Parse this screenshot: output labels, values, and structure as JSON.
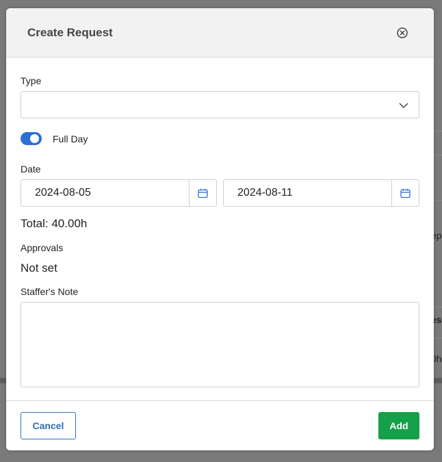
{
  "modal": {
    "title": "Create Request"
  },
  "form": {
    "type_label": "Type",
    "type_value": "",
    "full_day_label": "Full Day",
    "full_day_enabled": true,
    "date_label": "Date",
    "start_date": "2024-08-05",
    "end_date": "2024-08-11",
    "total_text": "Total: 40.00h",
    "approvals_label": "Approvals",
    "approvals_value": "Not set",
    "note_label": "Staffer's Note",
    "note_value": ""
  },
  "footer": {
    "cancel_label": "Cancel",
    "add_label": "Add"
  },
  "background": {
    "fragments": [
      "ep",
      "es",
      "0h"
    ]
  },
  "colors": {
    "primary": "#2d6fd1",
    "add_button": "#15a04a",
    "cancel_border": "#2f6fb5",
    "header_bg": "#f2f2f2"
  },
  "icons": {
    "close": "close-circle-icon",
    "dropdown": "chevron-down-icon",
    "calendar": "calendar-icon"
  }
}
